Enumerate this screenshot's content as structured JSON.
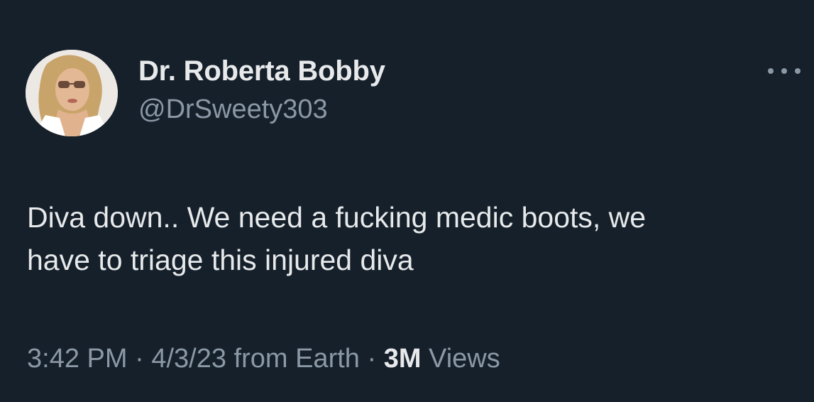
{
  "author": {
    "display_name": "Dr. Roberta Bobby",
    "handle": "@DrSweety303"
  },
  "more_icon": "more-horizontal-icon",
  "tweet": {
    "text_line1": "Diva down.. We need a fucking medic boots, we",
    "text_line2": "have to triage this injured diva"
  },
  "meta": {
    "time": "3:42 PM",
    "sep1": " · ",
    "date": "4/3/23",
    "source": " from Earth",
    "sep2": " · ",
    "views_count": "3M",
    "views_label": " Views"
  },
  "colors": {
    "background": "#15202b",
    "primary_text": "#e7e9ea",
    "secondary_text": "#8b98a5"
  }
}
